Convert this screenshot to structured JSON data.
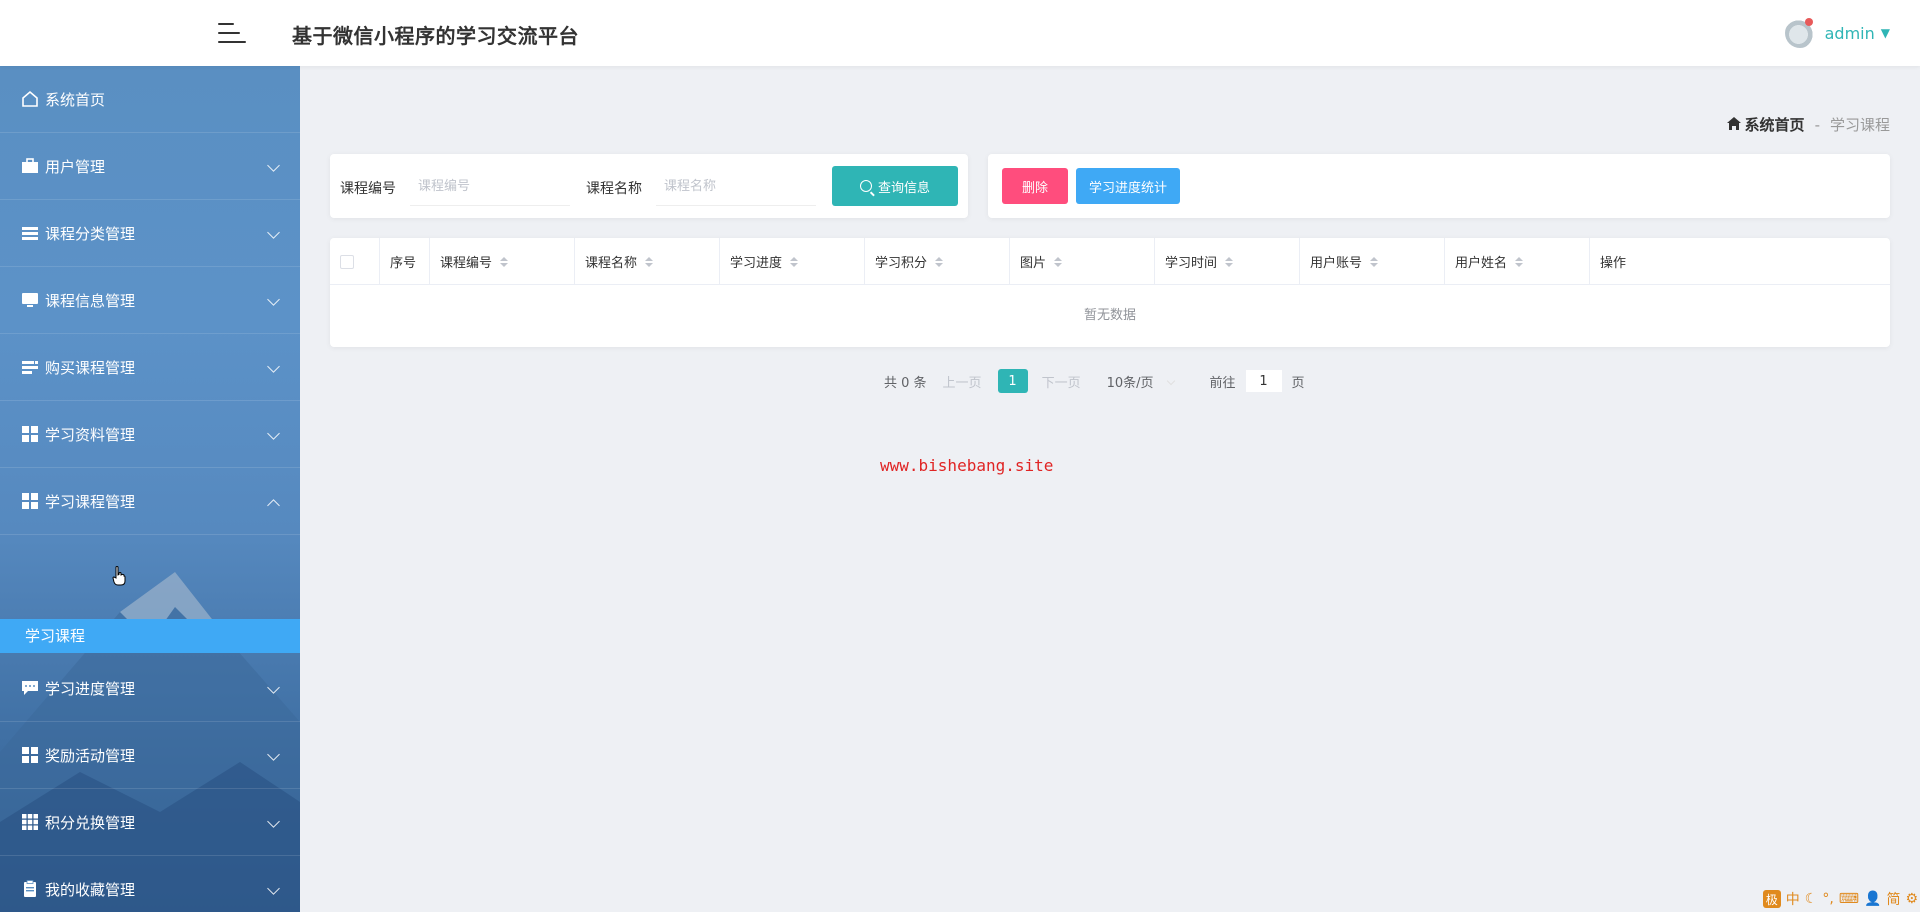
{
  "header": {
    "title": "基于微信小程序的学习交流平台",
    "username": "admin"
  },
  "sidebar": {
    "items": [
      {
        "label": "系统首页",
        "icon": "home-icon"
      },
      {
        "label": "用户管理",
        "icon": "briefcase-icon"
      },
      {
        "label": "课程分类管理",
        "icon": "list-icon"
      },
      {
        "label": "课程信息管理",
        "icon": "monitor-icon"
      },
      {
        "label": "购买课程管理",
        "icon": "tasks-icon"
      },
      {
        "label": "学习资料管理",
        "icon": "grid-icon"
      },
      {
        "label": "学习课程管理",
        "icon": "grid-icon"
      },
      {
        "label": "学习进度管理",
        "icon": "comment-icon"
      },
      {
        "label": "奖励活动管理",
        "icon": "grid-icon"
      },
      {
        "label": "积分兑换管理",
        "icon": "apps-icon"
      },
      {
        "label": "我的收藏管理",
        "icon": "clipboard-icon"
      }
    ],
    "active_sub": "学习课程"
  },
  "breadcrumb": {
    "home": "系统首页",
    "separator": "-",
    "current": "学习课程"
  },
  "search": {
    "field1_label": "课程编号",
    "field1_placeholder": "课程编号",
    "field2_label": "课程名称",
    "field2_placeholder": "课程名称",
    "query_button": "查询信息"
  },
  "actions": {
    "delete_button": "删除",
    "stats_button": "学习进度统计"
  },
  "table": {
    "columns": [
      "序号",
      "课程编号",
      "课程名称",
      "学习进度",
      "学习积分",
      "图片",
      "学习时间",
      "用户账号",
      "用户姓名",
      "操作"
    ],
    "empty_text": "暂无数据"
  },
  "pagination": {
    "total": "共 0 条",
    "prev": "上一页",
    "page": "1",
    "next": "下一页",
    "size": "10条/页",
    "goto": "前往",
    "jump_value": "1",
    "page_suffix": "页"
  },
  "watermark": "www.bishebang.site",
  "ime": {
    "logo": "极",
    "lang": "中",
    "mode": "简"
  },
  "colors": {
    "accent": "#2fb5b5",
    "delete": "#ff4d7d",
    "blue": "#3fa9f5"
  }
}
